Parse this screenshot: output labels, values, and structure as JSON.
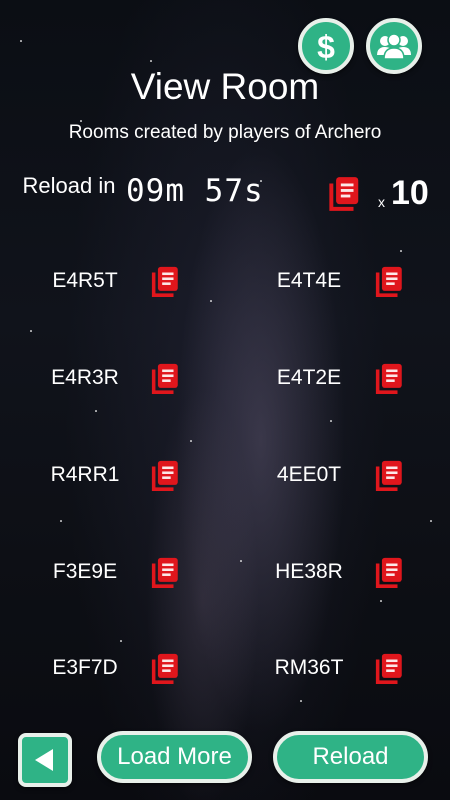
{
  "header": {
    "title": "View Room",
    "subtitle": "Rooms created by players of Archero",
    "money_button_icon": "dollar-icon",
    "group_button_icon": "group-icon"
  },
  "reload_info": {
    "label": "Reload in",
    "timer": "09m 57s",
    "multiplier_prefix": "x",
    "count": "10"
  },
  "rooms": [
    {
      "code": "E4R5T"
    },
    {
      "code": "E4T4E"
    },
    {
      "code": "E4R3R"
    },
    {
      "code": "E4T2E"
    },
    {
      "code": "R4RR1"
    },
    {
      "code": "4EE0T"
    },
    {
      "code": "F3E9E"
    },
    {
      "code": "HE38R"
    },
    {
      "code": "E3F7D"
    },
    {
      "code": "RM36T"
    }
  ],
  "footer": {
    "back_icon": "back-arrow-icon",
    "load_more_label": "Load More",
    "reload_label": "Reload"
  },
  "colors": {
    "button_green": "#2fb386",
    "button_border": "#e8f0ea",
    "copy_icon_red": "#e0161c"
  }
}
